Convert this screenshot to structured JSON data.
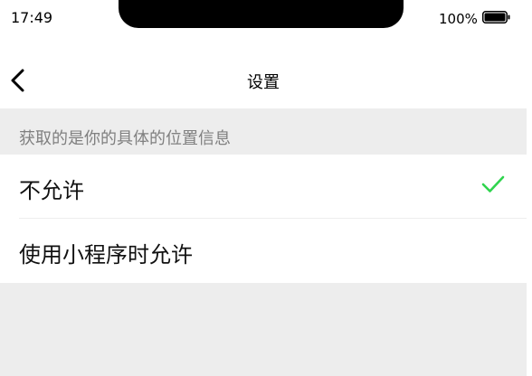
{
  "status_bar": {
    "time": "17:49",
    "battery": "100%",
    "battery_icon": "battery-full-icon"
  },
  "nav": {
    "back_icon": "chevron-left-icon",
    "title": "设置"
  },
  "section": {
    "header": "获取的是你的具体的位置信息"
  },
  "options": [
    {
      "label": "不允许",
      "selected": true
    },
    {
      "label": "使用小程序时允许",
      "selected": false
    }
  ],
  "colors": {
    "check": "#2fd44e",
    "background": "#ededed",
    "section_text": "#808080"
  }
}
